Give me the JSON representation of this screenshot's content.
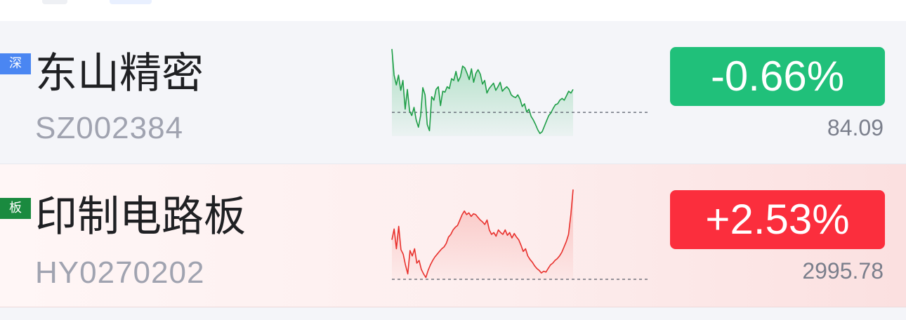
{
  "colors": {
    "down": "#20c07a",
    "up": "#fb2e3d",
    "badge_sz": "#4a86f2",
    "badge_board": "#1a8a3f"
  },
  "stocks": [
    {
      "badge": "深",
      "badge_color": "#4a86f2",
      "name": "东山精密",
      "code": "SZ002384",
      "change": "-0.66%",
      "change_color": "#20c07a",
      "price": "84.09",
      "trend": "down",
      "line_color": "#1e9e47",
      "fill_color": "#23b35a",
      "baseline": 0.265,
      "sparkline": [
        0.97,
        0.68,
        0.57,
        0.68,
        0.51,
        0.62,
        0.3,
        0.52,
        0.28,
        0.23,
        0.32,
        0.18,
        0.1,
        0.23,
        0.54,
        0.46,
        0.13,
        0.06,
        0.44,
        0.4,
        0.52,
        0.55,
        0.34,
        0.5,
        0.49,
        0.55,
        0.53,
        0.64,
        0.62,
        0.72,
        0.61,
        0.66,
        0.78,
        0.76,
        0.7,
        0.63,
        0.75,
        0.6,
        0.7,
        0.74,
        0.69,
        0.58,
        0.62,
        0.48,
        0.53,
        0.56,
        0.59,
        0.51,
        0.55,
        0.6,
        0.5,
        0.53,
        0.55,
        0.52,
        0.46,
        0.44,
        0.43,
        0.46,
        0.41,
        0.33,
        0.36,
        0.27,
        0.3,
        0.22,
        0.18,
        0.13,
        0.07,
        0.03,
        0.05,
        0.11,
        0.17,
        0.23,
        0.26,
        0.31,
        0.35,
        0.36,
        0.4,
        0.42,
        0.4,
        0.45,
        0.5,
        0.48,
        0.52
      ]
    },
    {
      "badge": "板",
      "badge_color": "#1a8a3f",
      "name": "印制电路板",
      "code": "HY0270202",
      "change": "+2.53%",
      "change_color": "#fb2e3d",
      "price": "2995.78",
      "trend": "up",
      "line_color": "#e8302c",
      "fill_color": "#f2716a",
      "baseline": 0.0,
      "sparkline": [
        0.44,
        0.56,
        0.34,
        0.59,
        0.33,
        0.28,
        0.16,
        0.06,
        0.32,
        0.26,
        0.34,
        0.18,
        0.21,
        0.11,
        0.06,
        0.02,
        0.1,
        0.16,
        0.21,
        0.25,
        0.28,
        0.31,
        0.34,
        0.36,
        0.4,
        0.47,
        0.5,
        0.55,
        0.58,
        0.6,
        0.66,
        0.72,
        0.76,
        0.72,
        0.74,
        0.7,
        0.73,
        0.72,
        0.69,
        0.66,
        0.64,
        0.61,
        0.66,
        0.55,
        0.5,
        0.52,
        0.48,
        0.55,
        0.52,
        0.5,
        0.55,
        0.49,
        0.52,
        0.46,
        0.51,
        0.47,
        0.44,
        0.38,
        0.31,
        0.34,
        0.26,
        0.22,
        0.19,
        0.15,
        0.12,
        0.1,
        0.07,
        0.09,
        0.08,
        0.12,
        0.16,
        0.18,
        0.21,
        0.23,
        0.26,
        0.3,
        0.36,
        0.42,
        0.5,
        0.72,
        1.0
      ]
    }
  ]
}
